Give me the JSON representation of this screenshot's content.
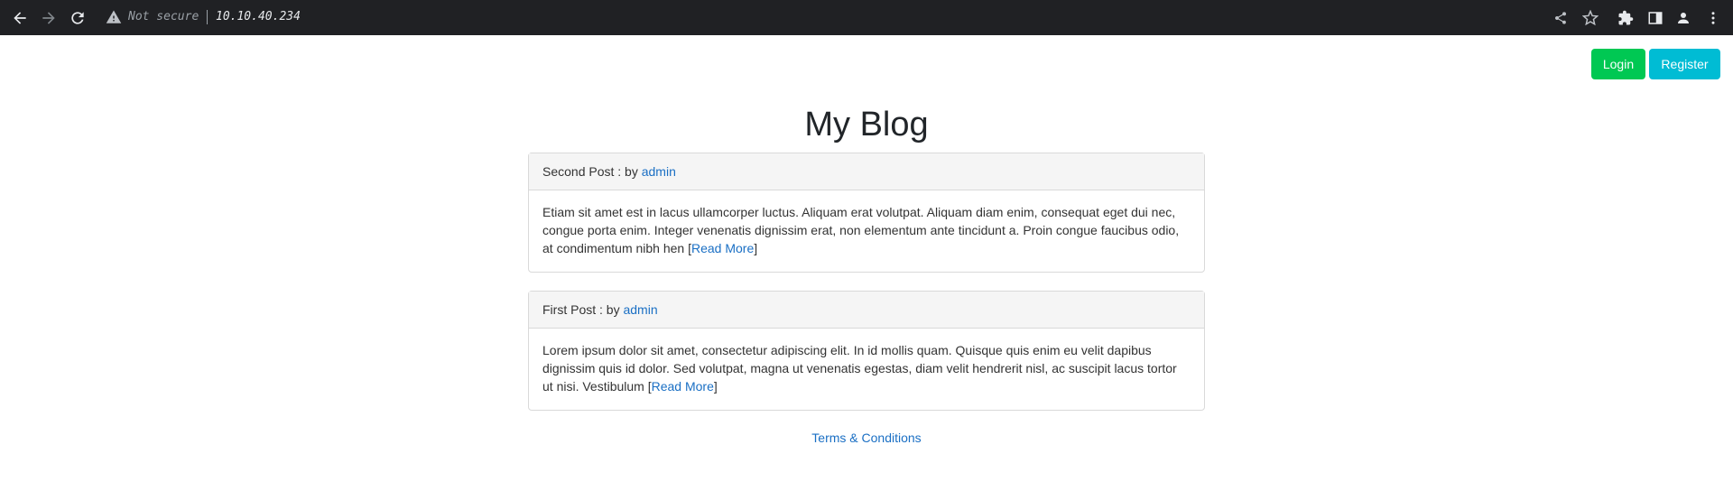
{
  "browser": {
    "security_status": "Not secure",
    "url": "10.10.40.234",
    "icons": [
      "back-icon",
      "forward-icon",
      "reload-icon",
      "warning-icon",
      "share-icon",
      "star-icon",
      "extensions-icon",
      "side-panel-icon",
      "profile-icon",
      "menu-icon"
    ]
  },
  "header": {
    "login_label": "Login",
    "register_label": "Register"
  },
  "colors": {
    "login": "#00c853",
    "register": "#00bcd4",
    "link": "#1a6fc4"
  },
  "blog": {
    "title": "My Blog",
    "posts": [
      {
        "title": "Second Post : by ",
        "author": "admin",
        "excerpt": "Etiam sit amet est in lacus ullamcorper luctus. Aliquam erat volutpat. Aliquam diam enim, consequat eget dui nec, congue porta enim. Integer venenatis dignissim erat, non elementum ante tincidunt a. Proin congue faucibus odio, at condimentum nibh hen ",
        "read_more": "Read More"
      },
      {
        "title": "First Post : by ",
        "author": "admin",
        "excerpt": "Lorem ipsum dolor sit amet, consectetur adipiscing elit. In id mollis quam. Quisque quis enim eu velit dapibus dignissim quis id dolor. Sed volutpat, magna ut venenatis egestas, diam velit hendrerit nisl, ac suscipit lacus tortor ut nisi. Vestibulum ",
        "read_more": "Read More"
      }
    ]
  },
  "footer": {
    "terms_label": "Terms & Conditions"
  }
}
